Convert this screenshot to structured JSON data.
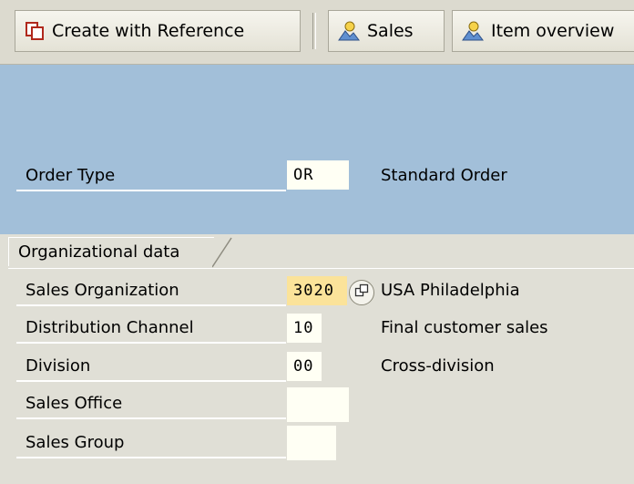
{
  "toolbar": {
    "create_ref_label": "Create with Reference",
    "sales_label": "Sales",
    "item_overview_label": "Item overview"
  },
  "header": {
    "order_type_label": "Order Type",
    "order_type_value": "OR",
    "order_type_desc": "Standard Order"
  },
  "org_data": {
    "tab_label": "Organizational data",
    "sales_org_label": "Sales Organization",
    "sales_org_value": "3020",
    "sales_org_desc": "USA Philadelphia",
    "dist_channel_label": "Distribution Channel",
    "dist_channel_value": "10",
    "dist_channel_desc": "Final customer sales",
    "division_label": "Division",
    "division_value": "00",
    "division_desc": "Cross-division",
    "sales_office_label": "Sales Office",
    "sales_office_value": "",
    "sales_group_label": "Sales Group",
    "sales_group_value": ""
  },
  "colors": {
    "panel_blue": "#a2bfd9",
    "required_field": "#fbe39a",
    "background": "#e0dfd6"
  },
  "icons": [
    "copy-document-icon",
    "person-mountain-icon",
    "value-help-icon"
  ]
}
